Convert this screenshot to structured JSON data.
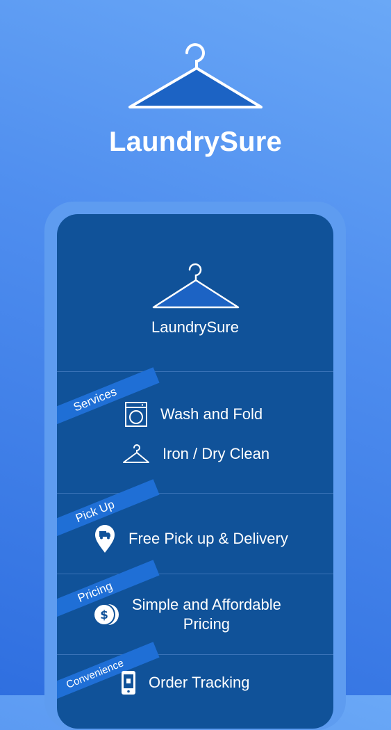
{
  "hero": {
    "title": "LaundrySure",
    "icon": "hanger-icon"
  },
  "app": {
    "title": "LaundrySure",
    "logo": "hanger-icon",
    "sections": [
      {
        "tag": "Services",
        "items": [
          {
            "icon": "washing-machine-icon",
            "label": "Wash and Fold"
          },
          {
            "icon": "hanger-icon",
            "label": "Iron / Dry Clean"
          }
        ]
      },
      {
        "tag": "Pick Up",
        "items": [
          {
            "icon": "delivery-pin-icon",
            "label": "Free Pick up & Delivery"
          }
        ]
      },
      {
        "tag": "Pricing",
        "items": [
          {
            "icon": "dollar-coins-icon",
            "label_line1": "Simple and Affordable",
            "label_line2": "Pricing"
          }
        ]
      },
      {
        "tag": "Convenience",
        "items": [
          {
            "icon": "phone-tracking-icon",
            "label": "Order Tracking"
          }
        ]
      }
    ]
  },
  "colors": {
    "screen": "#105299",
    "ribbon": "#1f6fd6",
    "phone_frame": "#5e9cf0"
  }
}
